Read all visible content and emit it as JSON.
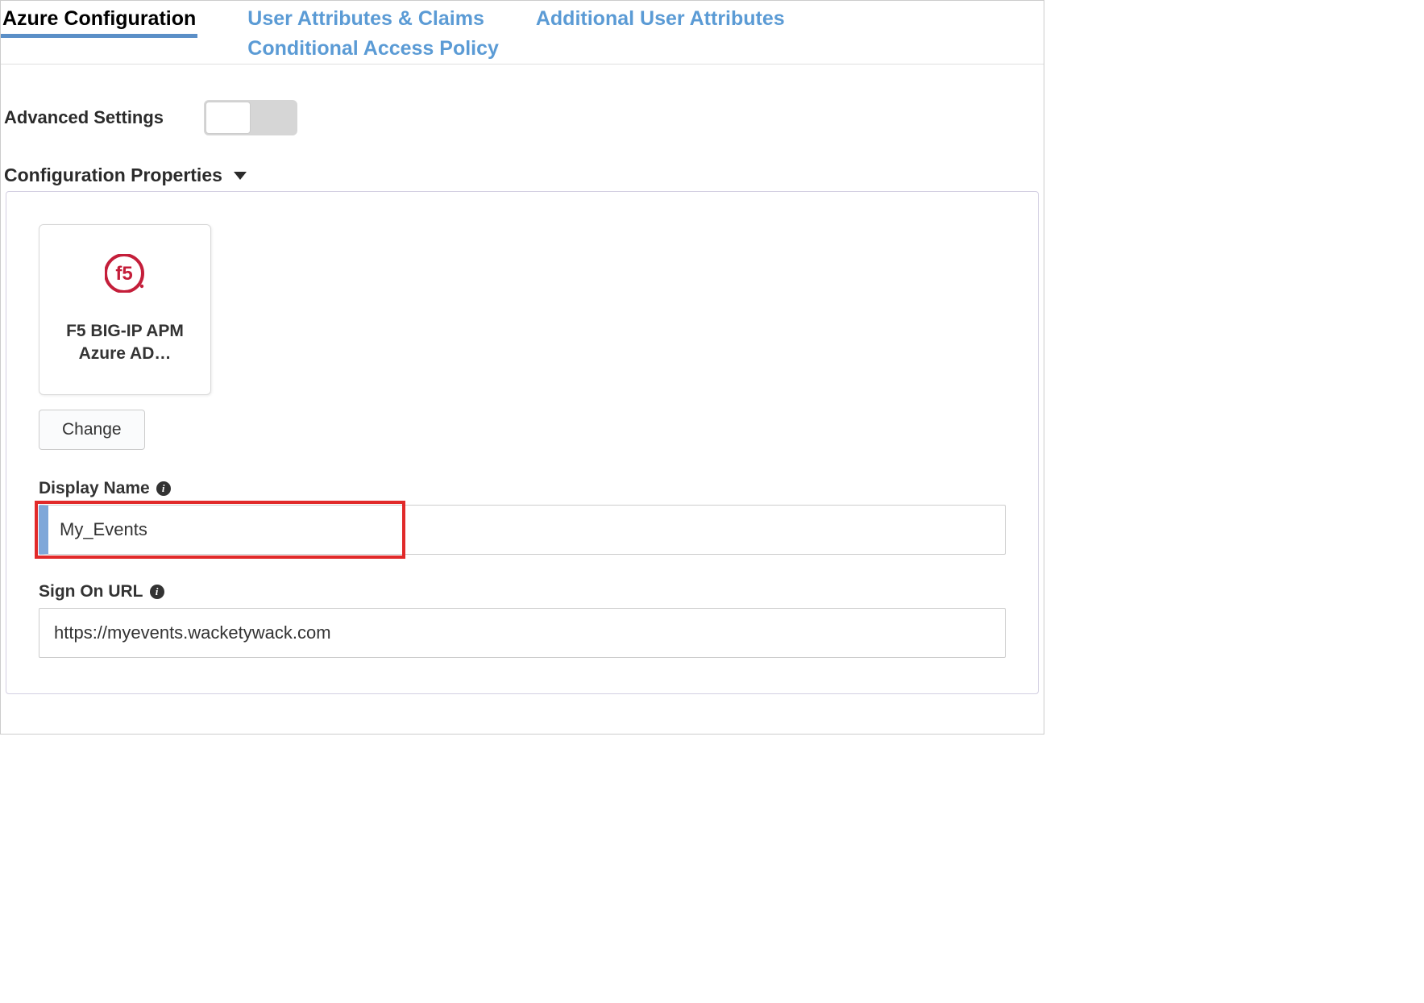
{
  "tabs": {
    "azure_config": "Azure Configuration",
    "user_attrs": "User Attributes & Claims",
    "additional_attrs": "Additional User Attributes",
    "cond_access": "Conditional Access Policy"
  },
  "advanced": {
    "label": "Advanced Settings",
    "enabled": false
  },
  "section": {
    "title": "Configuration Properties"
  },
  "app_card": {
    "line1": "F5 BIG-IP APM",
    "line2": "Azure AD…"
  },
  "buttons": {
    "change": "Change"
  },
  "fields": {
    "display_name": {
      "label": "Display Name",
      "value": "My_Events"
    },
    "sign_on_url": {
      "label": "Sign On URL",
      "value": "https://myevents.wacketywack.com"
    }
  }
}
